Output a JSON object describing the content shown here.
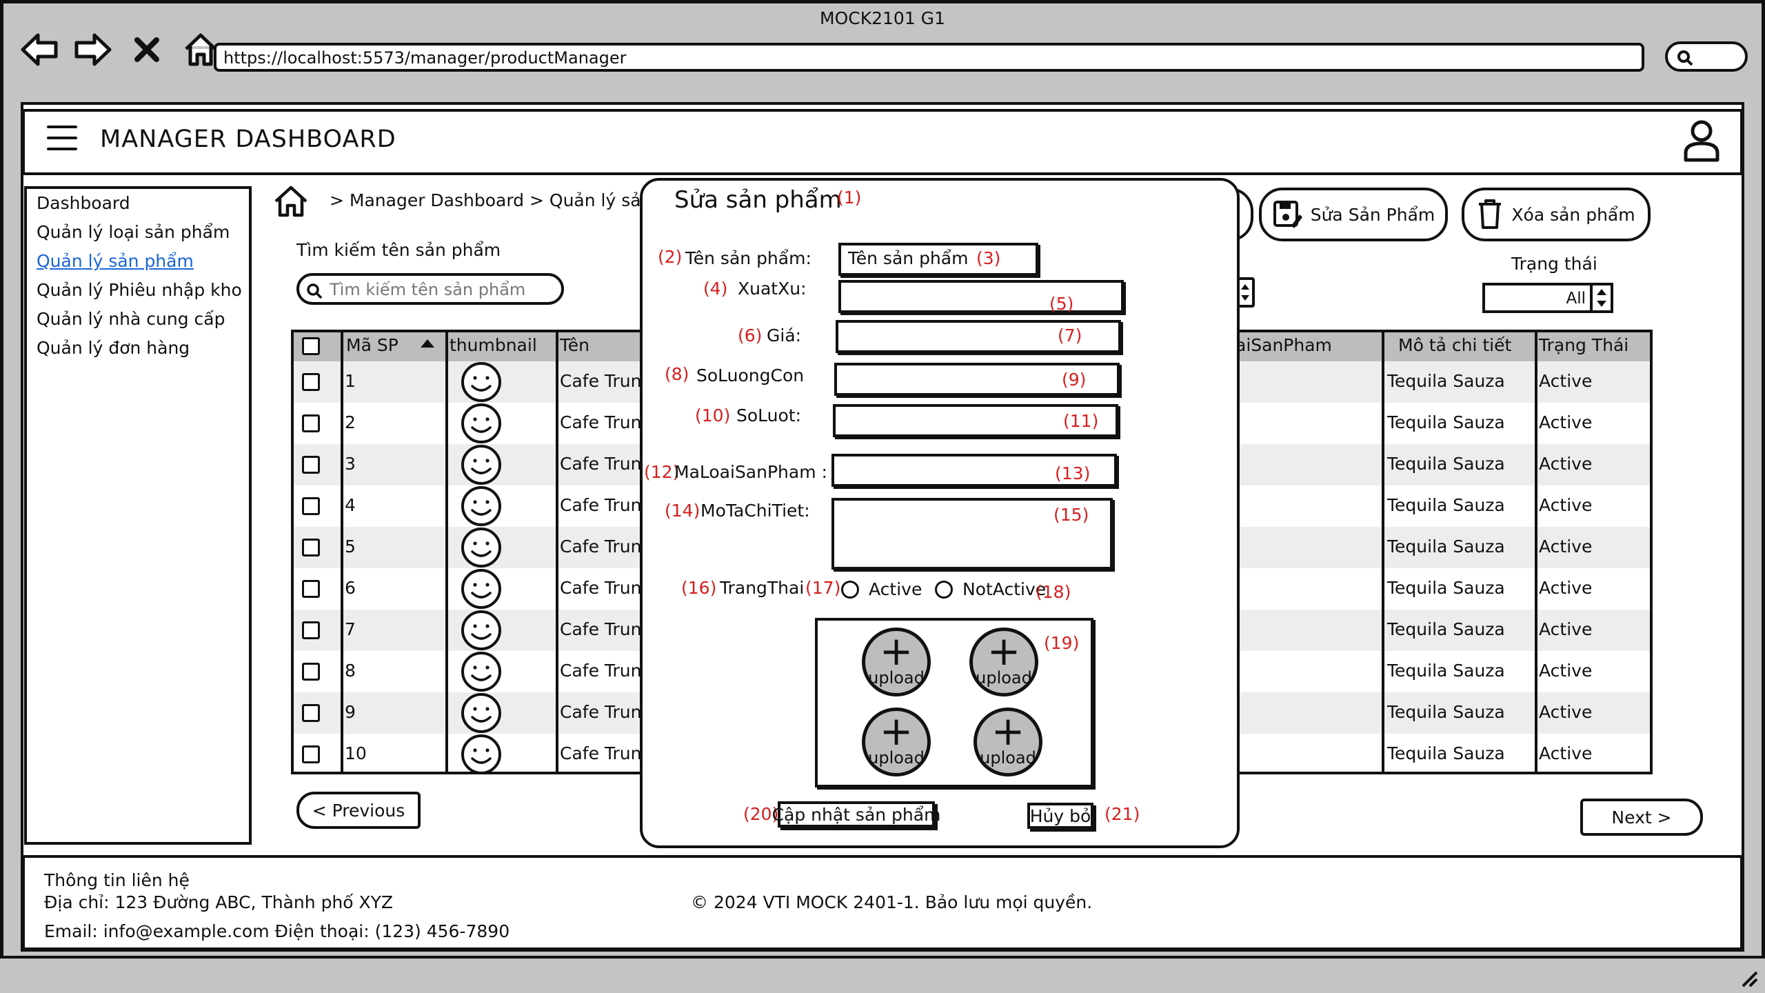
{
  "window": {
    "title": "MOCK2101 G1",
    "url": "https://localhost:5573/manager/productManager"
  },
  "header": {
    "title": "MANAGER DASHBOARD"
  },
  "sidebar": {
    "items": [
      {
        "label": "Dashboard"
      },
      {
        "label": "Quản lý loại sản phẩm"
      },
      {
        "label": "Quản lý sản phẩm"
      },
      {
        "label": "Quản lý Phiêu nhập kho"
      },
      {
        "label": "Quản lý nhà cung cấp"
      },
      {
        "label": "Quản lý đơn hàng"
      }
    ]
  },
  "breadcrumb": "> Manager Dashboard > Quản lý sản p",
  "search": {
    "label": "Tìm kiếm tên sản phẩm",
    "placeholder": "Tìm kiếm tên sản phẩm"
  },
  "toolbar": {
    "edit_label": "Sửa Sản Phẩm",
    "delete_label": "Xóa sản phẩm"
  },
  "status_filter": {
    "label": "Trạng thái",
    "value": "All"
  },
  "table": {
    "headers": {
      "id": "Mã SP",
      "thumbnail": "thumbnail",
      "name": "Tên",
      "category": "aiSanPham",
      "description": "Mô tả chi tiết",
      "status": "Trạng Thái"
    },
    "rows": [
      {
        "id": "1",
        "name": "Cafe Trun",
        "description": "Tequila Sauza",
        "status": "Active"
      },
      {
        "id": "2",
        "name": "Cafe Trun",
        "description": "Tequila Sauza",
        "status": "Active"
      },
      {
        "id": "3",
        "name": "Cafe Trun",
        "description": "Tequila Sauza",
        "status": "Active"
      },
      {
        "id": "4",
        "name": "Cafe Trun",
        "description": "Tequila Sauza",
        "status": "Active"
      },
      {
        "id": "5",
        "name": "Cafe Trun",
        "description": "Tequila Sauza",
        "status": "Active"
      },
      {
        "id": "6",
        "name": "Cafe Trun",
        "description": "Tequila Sauza",
        "status": "Active"
      },
      {
        "id": "7",
        "name": "Cafe Trun",
        "description": "Tequila Sauza",
        "status": "Active"
      },
      {
        "id": "8",
        "name": "Cafe Trun",
        "description": "Tequila Sauza",
        "status": "Active"
      },
      {
        "id": "9",
        "name": "Cafe Trun",
        "description": "Tequila Sauza",
        "status": "Active"
      },
      {
        "id": "10",
        "name": "Cafe Trun",
        "description": "Tequila Sauza",
        "status": "Active"
      }
    ]
  },
  "pagination": {
    "prev": "< Previous",
    "next": "Next >"
  },
  "footer": {
    "contact_title": "Thông tin liên hệ",
    "address": "Địa chỉ: 123 Đường ABC, Thành phố XYZ",
    "contact_line": "Email: info@example.com  Điện thoại: (123) 456-7890",
    "copyright": "© 2024 VTI MOCK 2401-1. Bảo lưu mọi quyền."
  },
  "modal": {
    "title": "Sửa sản phẩm",
    "title_num": "(1)",
    "fields": [
      {
        "num": "(2)",
        "label": "Tên sản phẩm:",
        "value": "Tên sản phẩm",
        "value_num": "(3)"
      },
      {
        "num": "(4)",
        "label": "XuatXu:",
        "value_num": "(5)"
      },
      {
        "num": "(6)",
        "label": "Giá:",
        "value_num": "(7)"
      },
      {
        "num": "(8)",
        "label": "SoLuongCon",
        "value_num": "(9)"
      },
      {
        "num": "(10)",
        "label": "SoLuot:",
        "value_num": "(11)"
      },
      {
        "num": "(12)",
        "label": "MaLoaiSanPham :",
        "value_num": "(13)"
      },
      {
        "num": "(14)",
        "label": "MoTaChiTiet:",
        "value_num": "(15)"
      }
    ],
    "status": {
      "num": "(16)",
      "label": "TrangThai",
      "active_num": "(17)",
      "active_label": "Active",
      "inactive_label": "NotActive",
      "inactive_num": "(18)"
    },
    "uploads": {
      "num": "(19)",
      "label": "upload",
      "plus": "+"
    },
    "submit": {
      "num": "(20)",
      "label": "Cập nhật sản phẩm"
    },
    "cancel": {
      "num": "(21)",
      "label": "Hủy bỏ"
    }
  }
}
